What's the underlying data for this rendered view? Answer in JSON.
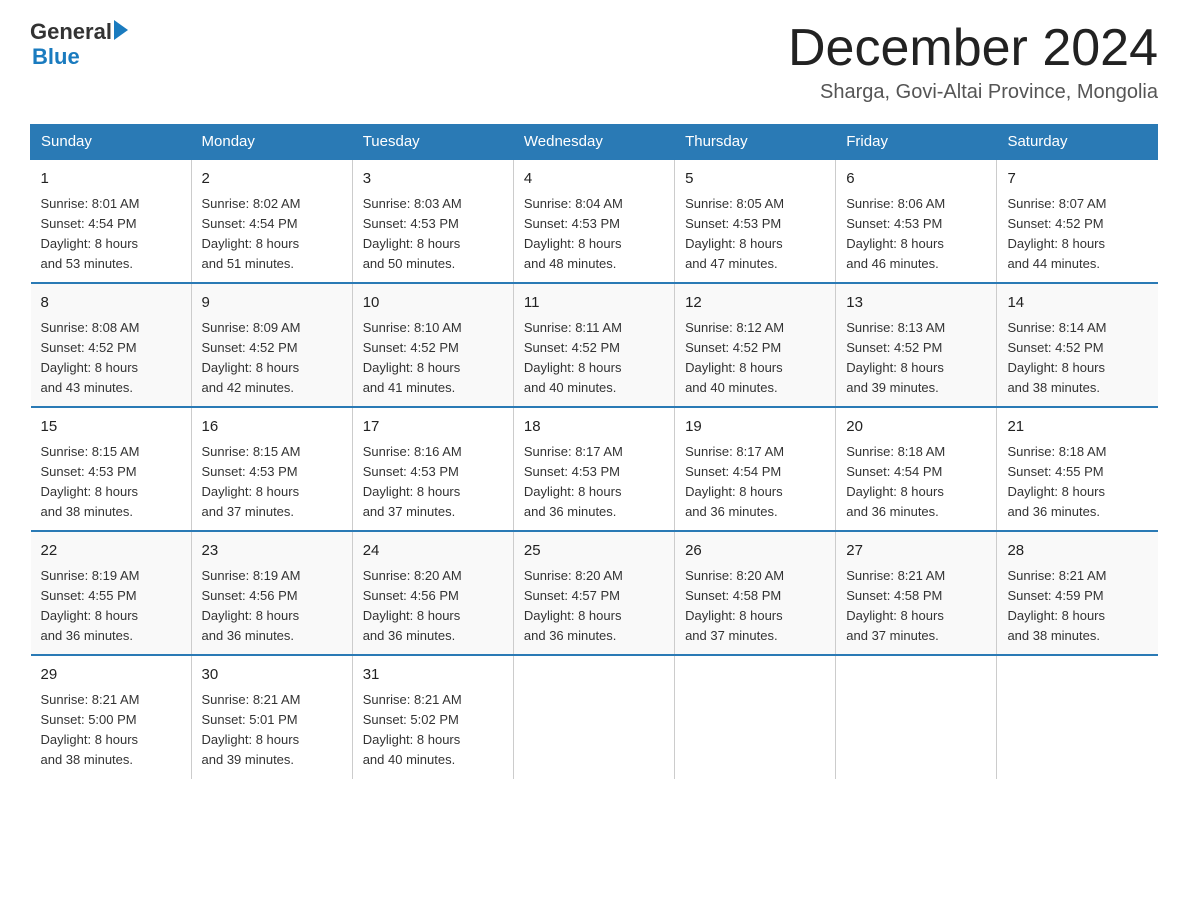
{
  "logo": {
    "general": "General",
    "triangle": "",
    "blue": "Blue"
  },
  "title": "December 2024",
  "location": "Sharga, Govi-Altai Province, Mongolia",
  "days_of_week": [
    "Sunday",
    "Monday",
    "Tuesday",
    "Wednesday",
    "Thursday",
    "Friday",
    "Saturday"
  ],
  "weeks": [
    [
      {
        "day": "1",
        "sunrise": "8:01 AM",
        "sunset": "4:54 PM",
        "daylight": "8 hours and 53 minutes."
      },
      {
        "day": "2",
        "sunrise": "8:02 AM",
        "sunset": "4:54 PM",
        "daylight": "8 hours and 51 minutes."
      },
      {
        "day": "3",
        "sunrise": "8:03 AM",
        "sunset": "4:53 PM",
        "daylight": "8 hours and 50 minutes."
      },
      {
        "day": "4",
        "sunrise": "8:04 AM",
        "sunset": "4:53 PM",
        "daylight": "8 hours and 48 minutes."
      },
      {
        "day": "5",
        "sunrise": "8:05 AM",
        "sunset": "4:53 PM",
        "daylight": "8 hours and 47 minutes."
      },
      {
        "day": "6",
        "sunrise": "8:06 AM",
        "sunset": "4:53 PM",
        "daylight": "8 hours and 46 minutes."
      },
      {
        "day": "7",
        "sunrise": "8:07 AM",
        "sunset": "4:52 PM",
        "daylight": "8 hours and 44 minutes."
      }
    ],
    [
      {
        "day": "8",
        "sunrise": "8:08 AM",
        "sunset": "4:52 PM",
        "daylight": "8 hours and 43 minutes."
      },
      {
        "day": "9",
        "sunrise": "8:09 AM",
        "sunset": "4:52 PM",
        "daylight": "8 hours and 42 minutes."
      },
      {
        "day": "10",
        "sunrise": "8:10 AM",
        "sunset": "4:52 PM",
        "daylight": "8 hours and 41 minutes."
      },
      {
        "day": "11",
        "sunrise": "8:11 AM",
        "sunset": "4:52 PM",
        "daylight": "8 hours and 40 minutes."
      },
      {
        "day": "12",
        "sunrise": "8:12 AM",
        "sunset": "4:52 PM",
        "daylight": "8 hours and 40 minutes."
      },
      {
        "day": "13",
        "sunrise": "8:13 AM",
        "sunset": "4:52 PM",
        "daylight": "8 hours and 39 minutes."
      },
      {
        "day": "14",
        "sunrise": "8:14 AM",
        "sunset": "4:52 PM",
        "daylight": "8 hours and 38 minutes."
      }
    ],
    [
      {
        "day": "15",
        "sunrise": "8:15 AM",
        "sunset": "4:53 PM",
        "daylight": "8 hours and 38 minutes."
      },
      {
        "day": "16",
        "sunrise": "8:15 AM",
        "sunset": "4:53 PM",
        "daylight": "8 hours and 37 minutes."
      },
      {
        "day": "17",
        "sunrise": "8:16 AM",
        "sunset": "4:53 PM",
        "daylight": "8 hours and 37 minutes."
      },
      {
        "day": "18",
        "sunrise": "8:17 AM",
        "sunset": "4:53 PM",
        "daylight": "8 hours and 36 minutes."
      },
      {
        "day": "19",
        "sunrise": "8:17 AM",
        "sunset": "4:54 PM",
        "daylight": "8 hours and 36 minutes."
      },
      {
        "day": "20",
        "sunrise": "8:18 AM",
        "sunset": "4:54 PM",
        "daylight": "8 hours and 36 minutes."
      },
      {
        "day": "21",
        "sunrise": "8:18 AM",
        "sunset": "4:55 PM",
        "daylight": "8 hours and 36 minutes."
      }
    ],
    [
      {
        "day": "22",
        "sunrise": "8:19 AM",
        "sunset": "4:55 PM",
        "daylight": "8 hours and 36 minutes."
      },
      {
        "day": "23",
        "sunrise": "8:19 AM",
        "sunset": "4:56 PM",
        "daylight": "8 hours and 36 minutes."
      },
      {
        "day": "24",
        "sunrise": "8:20 AM",
        "sunset": "4:56 PM",
        "daylight": "8 hours and 36 minutes."
      },
      {
        "day": "25",
        "sunrise": "8:20 AM",
        "sunset": "4:57 PM",
        "daylight": "8 hours and 36 minutes."
      },
      {
        "day": "26",
        "sunrise": "8:20 AM",
        "sunset": "4:58 PM",
        "daylight": "8 hours and 37 minutes."
      },
      {
        "day": "27",
        "sunrise": "8:21 AM",
        "sunset": "4:58 PM",
        "daylight": "8 hours and 37 minutes."
      },
      {
        "day": "28",
        "sunrise": "8:21 AM",
        "sunset": "4:59 PM",
        "daylight": "8 hours and 38 minutes."
      }
    ],
    [
      {
        "day": "29",
        "sunrise": "8:21 AM",
        "sunset": "5:00 PM",
        "daylight": "8 hours and 38 minutes."
      },
      {
        "day": "30",
        "sunrise": "8:21 AM",
        "sunset": "5:01 PM",
        "daylight": "8 hours and 39 minutes."
      },
      {
        "day": "31",
        "sunrise": "8:21 AM",
        "sunset": "5:02 PM",
        "daylight": "8 hours and 40 minutes."
      },
      null,
      null,
      null,
      null
    ]
  ],
  "labels": {
    "sunrise": "Sunrise:",
    "sunset": "Sunset:",
    "daylight": "Daylight:"
  }
}
